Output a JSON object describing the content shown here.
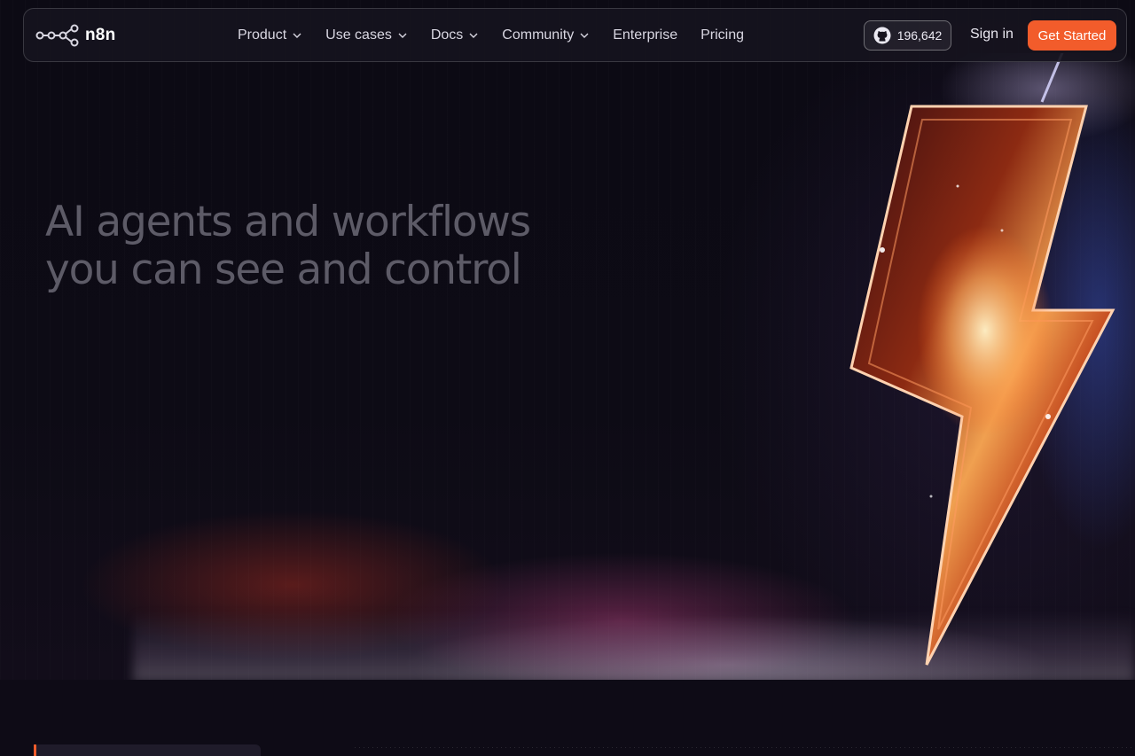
{
  "brand": {
    "name": "n8n"
  },
  "nav": {
    "items": [
      {
        "label": "Product",
        "has_dropdown": true
      },
      {
        "label": "Use cases",
        "has_dropdown": true
      },
      {
        "label": "Docs",
        "has_dropdown": true
      },
      {
        "label": "Community",
        "has_dropdown": true
      },
      {
        "label": "Enterprise",
        "has_dropdown": false
      },
      {
        "label": "Pricing",
        "has_dropdown": false
      }
    ],
    "github_stars": "196,642",
    "github_icon": "github-icon",
    "sign_in": "Sign in",
    "cta": "Get Started"
  },
  "hero": {
    "title_line1": "AI agents and workflows",
    "title_line2": "you can see and control"
  },
  "colors": {
    "accent": "#f25c2b",
    "background": "#0e0b16",
    "title": "#5d5b67"
  }
}
